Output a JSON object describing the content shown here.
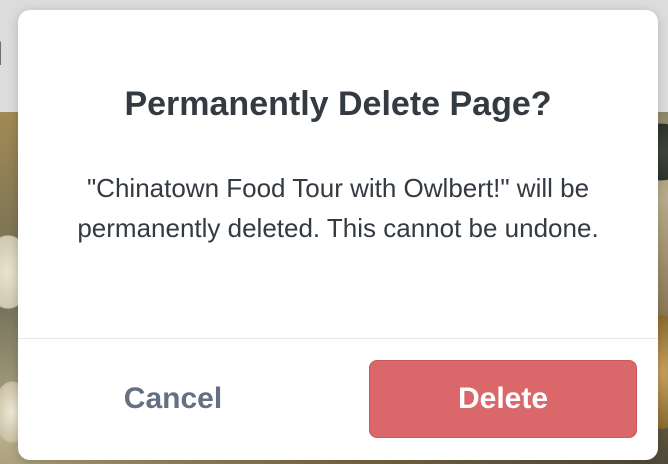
{
  "background": {
    "header_text": "l l"
  },
  "dialog": {
    "title": "Permanently Delete Page?",
    "message": "\"Chinatown Food Tour with Owlbert!\" will be permanently deleted. This cannot be undone.",
    "cancel_label": "Cancel",
    "delete_label": "Delete"
  },
  "colors": {
    "title_text": "#333a41",
    "cancel_text": "#647184",
    "delete_bg": "#da686b",
    "delete_text": "#ffffff",
    "dialog_bg": "#ffffff"
  }
}
